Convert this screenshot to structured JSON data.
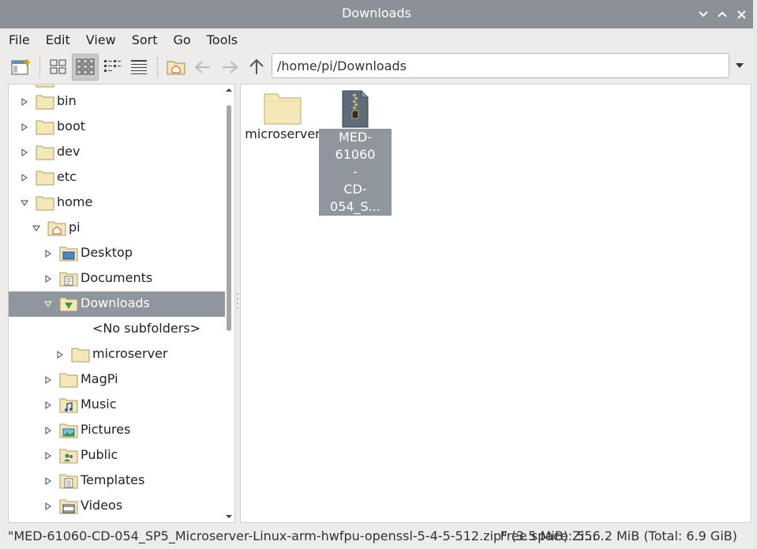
{
  "window": {
    "title": "Downloads"
  },
  "menu": [
    "File",
    "Edit",
    "View",
    "Sort",
    "Go",
    "Tools"
  ],
  "path": {
    "value": "/home/pi/Downloads"
  },
  "tree": [
    {
      "label": "bin",
      "depth": 0,
      "expander": "collapsed",
      "icon": "folder"
    },
    {
      "label": "boot",
      "depth": 0,
      "expander": "collapsed",
      "icon": "folder"
    },
    {
      "label": "dev",
      "depth": 0,
      "expander": "collapsed",
      "icon": "folder"
    },
    {
      "label": "etc",
      "depth": 0,
      "expander": "collapsed",
      "icon": "folder"
    },
    {
      "label": "home",
      "depth": 0,
      "expander": "expanded",
      "icon": "folder"
    },
    {
      "label": "pi",
      "depth": 1,
      "expander": "expanded",
      "icon": "home-folder"
    },
    {
      "label": "Desktop",
      "depth": 2,
      "expander": "collapsed",
      "icon": "desktop-folder"
    },
    {
      "label": "Documents",
      "depth": 2,
      "expander": "collapsed",
      "icon": "documents-folder"
    },
    {
      "label": "Downloads",
      "depth": 2,
      "expander": "expanded",
      "icon": "downloads-folder",
      "selected": true
    },
    {
      "label": "<No subfolders>",
      "depth": 3,
      "expander": "none",
      "icon": "none"
    },
    {
      "label": "microserver",
      "depth": 3,
      "expander": "collapsed",
      "icon": "folder"
    },
    {
      "label": "MagPi",
      "depth": 2,
      "expander": "collapsed",
      "icon": "folder"
    },
    {
      "label": "Music",
      "depth": 2,
      "expander": "collapsed",
      "icon": "music-folder"
    },
    {
      "label": "Pictures",
      "depth": 2,
      "expander": "collapsed",
      "icon": "pictures-folder"
    },
    {
      "label": "Public",
      "depth": 2,
      "expander": "collapsed",
      "icon": "public-folder"
    },
    {
      "label": "Templates",
      "depth": 2,
      "expander": "collapsed",
      "icon": "templates-folder"
    },
    {
      "label": "Videos",
      "depth": 2,
      "expander": "collapsed",
      "icon": "videos-folder"
    }
  ],
  "files": [
    {
      "name": "microserver",
      "line1": "microserver",
      "line2": "",
      "line3": "",
      "icon": "folder",
      "selected": false
    },
    {
      "name": "MED-61060-CD-054_SP5_Microserver-Linux-arm-hwfpu-openssl-5-4-5-512.zip",
      "line1": "MED-61060",
      "line2": "-",
      "line3": "CD-054_S...",
      "icon": "zip",
      "selected": true
    }
  ],
  "status": {
    "left": "\"MED-61060-CD-054_SP5_Microserver-Linux-arm-hwfpu-openssl-5-4-5-512.zip\" (3.5 MiB) Zi...",
    "right": "Free space: 556.2 MiB (Total: 6.9 GiB)"
  },
  "colors": {
    "selection": "#8f969d",
    "titlebar": "#8b9197",
    "folder": "#f4e7b8"
  }
}
